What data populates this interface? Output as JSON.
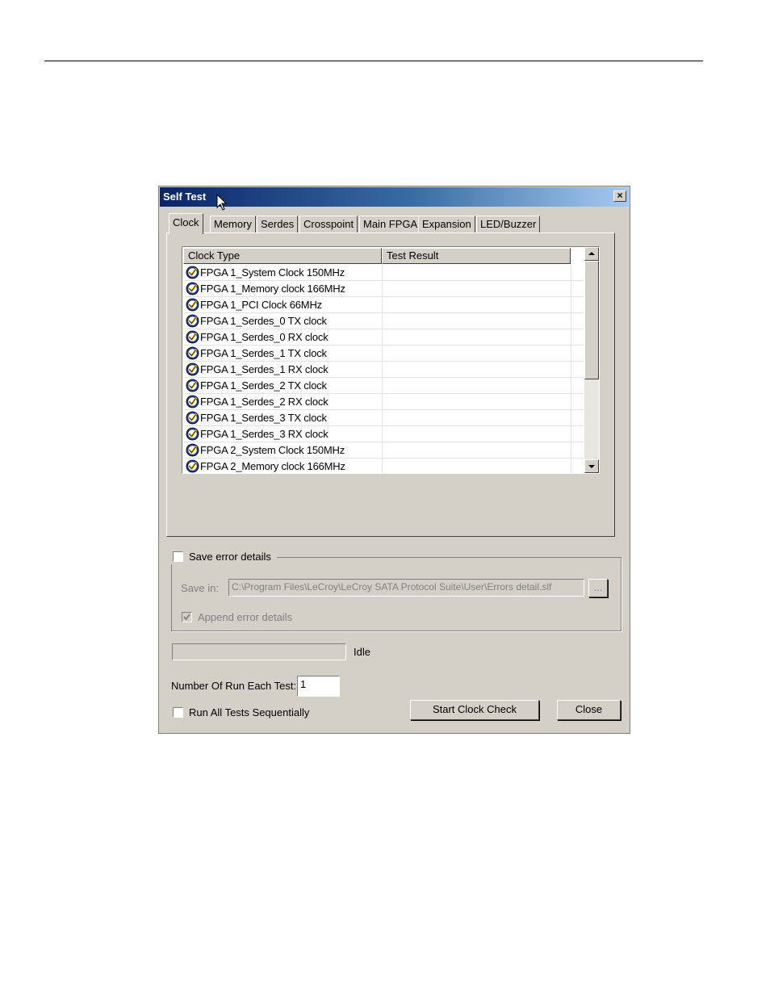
{
  "dialog": {
    "title": "Self Test",
    "close_glyph": "×"
  },
  "tabs": [
    {
      "label": "Clock",
      "active": true
    },
    {
      "label": "Memory"
    },
    {
      "label": "Serdes"
    },
    {
      "label": "Crosspoint"
    },
    {
      "label": "Main FPGA"
    },
    {
      "label": "Expansion"
    },
    {
      "label": "LED/Buzzer"
    }
  ],
  "list": {
    "columns": [
      "Clock Type",
      "Test Result"
    ],
    "rows": [
      "FPGA 1_System Clock 150MHz",
      "FPGA 1_Memory clock 166MHz",
      "FPGA 1_PCI Clock 66MHz",
      "FPGA 1_Serdes_0 TX clock",
      "FPGA 1_Serdes_0 RX clock",
      "FPGA 1_Serdes_1 TX clock",
      "FPGA 1_Serdes_1 RX clock",
      "FPGA 1_Serdes_2 TX clock",
      "FPGA 1_Serdes_2 RX clock",
      "FPGA 1_Serdes_3 TX clock",
      "FPGA 1_Serdes_3 RX clock",
      "FPGA 2_System Clock 150MHz",
      "FPGA 2_Memory clock 166MHz"
    ],
    "row_icon": "check-badge-icon"
  },
  "error_group": {
    "save_checkbox_label": "Save error details",
    "save_checked": false,
    "save_in_label": "Save in:",
    "path_value": "C:\\Program Files\\LeCroy\\LeCroy SATA Protocol Suite\\User\\Errors detail.slf",
    "browse_label": "...",
    "append_label": "Append error details",
    "append_checked": true
  },
  "status": {
    "progress_fraction": 0,
    "text": "Idle"
  },
  "run": {
    "count_label": "Number Of Run Each Test:",
    "count_value": "1",
    "sequential_label": "Run All Tests Sequentially",
    "sequential_checked": false
  },
  "buttons": {
    "start": "Start Clock Check",
    "close": "Close"
  },
  "colors": {
    "title_gradient_start": "#0a246a",
    "title_gradient_end": "#a6caf0",
    "dialog_face": "#d4d0c8",
    "check_badge": "#1a3aa0",
    "check_mark": "#f0d000"
  }
}
